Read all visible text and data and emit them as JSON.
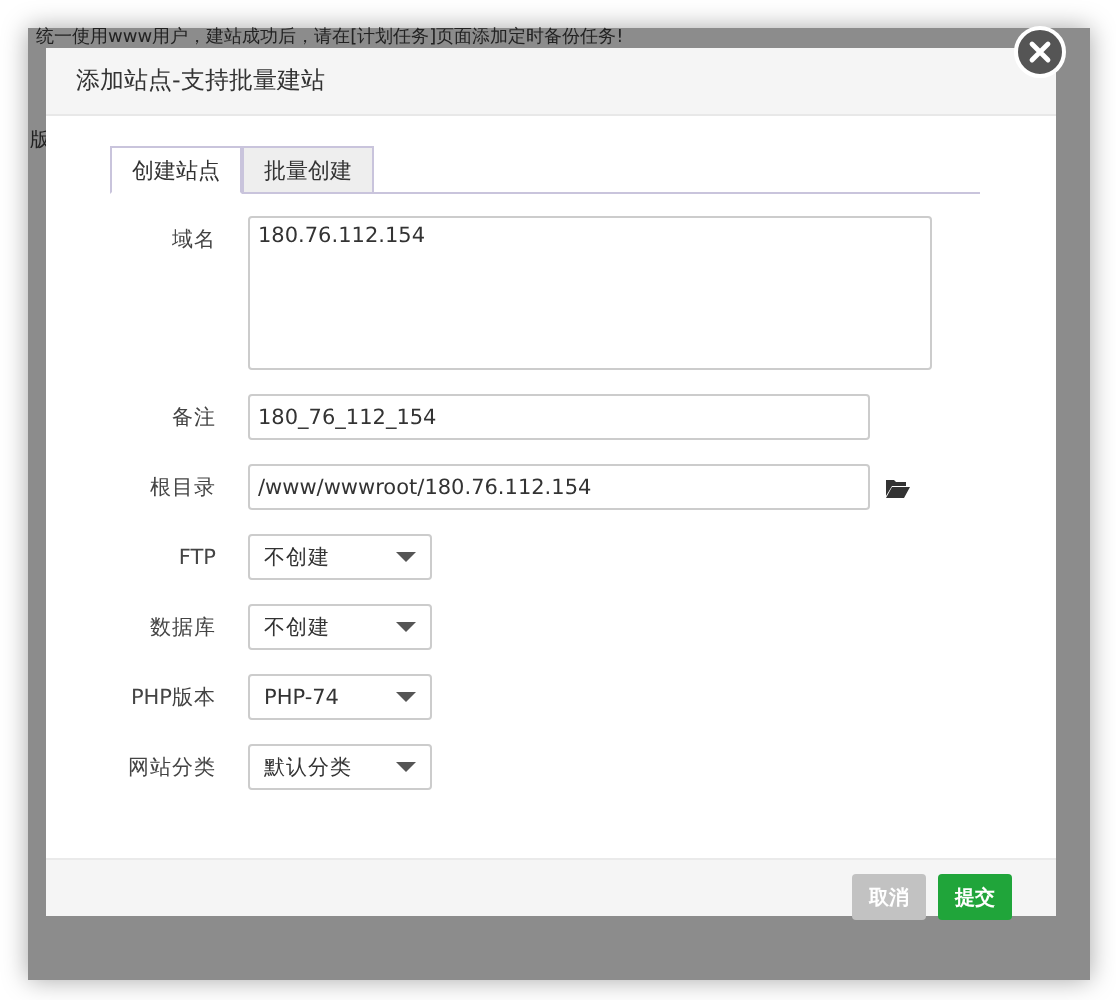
{
  "background": {
    "notice": "统一使用www用户，建站成功后，请在[计划任务]页面添加定时备份任务!",
    "side_text": "版"
  },
  "dialog": {
    "title": "添加站点-支持批量建站",
    "tabs": [
      {
        "label": "创建站点",
        "selected": true
      },
      {
        "label": "批量创建",
        "selected": false
      }
    ],
    "fields": [
      {
        "kind": "textarea",
        "label": "域名",
        "value": "180.76.112.154"
      },
      {
        "kind": "text",
        "label": "备注",
        "value": "180_76_112_154"
      },
      {
        "kind": "path",
        "label": "根目录",
        "value": "/www/wwwroot/180.76.112.154"
      },
      {
        "kind": "select",
        "label": "FTP",
        "value": "不创建"
      },
      {
        "kind": "select",
        "label": "数据库",
        "value": "不创建"
      },
      {
        "kind": "select",
        "label": "PHP版本",
        "value": "PHP-74"
      },
      {
        "kind": "select",
        "label": "网站分类",
        "value": "默认分类"
      }
    ],
    "buttons": [
      {
        "label": "取消",
        "kind": "cancel"
      },
      {
        "label": "提交",
        "kind": "submit"
      }
    ]
  }
}
